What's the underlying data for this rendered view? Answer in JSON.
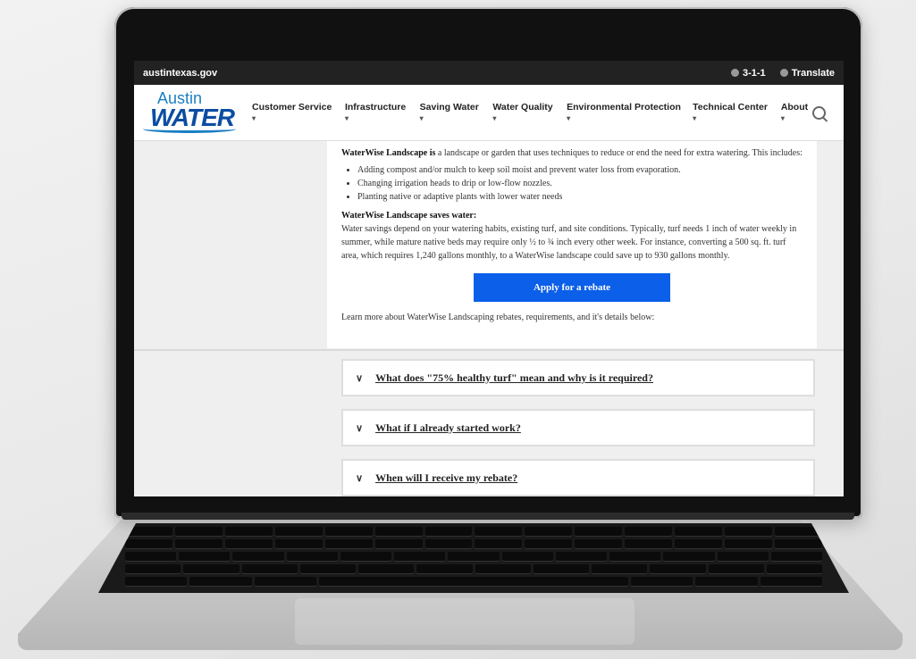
{
  "topbar": {
    "site": "austintexas.gov",
    "phone": "3-1-1",
    "translate": "Translate"
  },
  "logo": {
    "line1": "Austin",
    "line2": "WATER"
  },
  "nav": [
    "Customer Service",
    "Infrastructure",
    "Saving Water",
    "Water Quality",
    "Environmental Protection",
    "Technical Center",
    "About"
  ],
  "intro": {
    "lead_bold": "WaterWise Landscape is",
    "lead_rest": " a landscape or garden that uses techniques to reduce or end the need for extra watering. This includes:",
    "bullets": [
      "Adding compost and/or mulch to keep soil moist and prevent water loss from evaporation.",
      "Changing irrigation heads to drip or low-flow nozzles.",
      "Planting native or adaptive plants with lower water needs"
    ],
    "saves_heading": "WaterWise Landscape saves water:",
    "saves_text": "Water savings depend on your watering habits, existing turf, and site conditions. Typically, turf needs 1 inch of water weekly in summer, while mature native beds may require only ½ to ¾ inch every other week. For instance, converting a 500 sq. ft. turf area, which requires 1,240 gallons monthly, to a WaterWise landscape could save up to 930 gallons monthly.",
    "button": "Apply for a rebate",
    "learn_more": "Learn more about WaterWise Landscaping rebates, requirements, and it's details below:"
  },
  "faq": [
    "What does \"75% healthy turf\" mean and why is it required?",
    "What if I already started work?",
    "When will I receive my rebate?"
  ]
}
